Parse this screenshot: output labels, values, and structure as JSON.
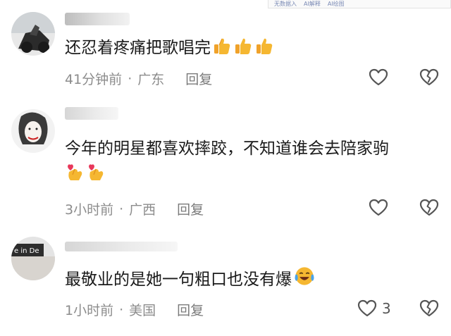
{
  "topbar": {
    "items": [
      "无数据入",
      "AI解释",
      "AI绘图"
    ]
  },
  "comments": [
    {
      "text": "还忍着疼痛把歌唱完",
      "emoji": [
        "thumbs-up",
        "thumbs-up",
        "thumbs-up"
      ],
      "time": "41分钟前",
      "location": "广东",
      "reply_label": "回复",
      "like_count": ""
    },
    {
      "text": "今年的明星都喜欢摔跤，不知道谁会去陪家驹",
      "emoji": [
        "finger-heart",
        "finger-heart"
      ],
      "time": "3小时前",
      "location": "广西",
      "reply_label": "回复",
      "like_count": ""
    },
    {
      "text": "最敬业的是她一句粗口也没有爆",
      "emoji": [
        "tears-of-joy"
      ],
      "time": "1小时前",
      "location": "美国",
      "reply_label": "回复",
      "like_count": "3"
    }
  ],
  "colors": {
    "text": "#1a1a1a",
    "meta": "#8c8c8c",
    "icon": "#555555",
    "emoji_yellow": "#f5b731"
  },
  "meta_separator": "·"
}
